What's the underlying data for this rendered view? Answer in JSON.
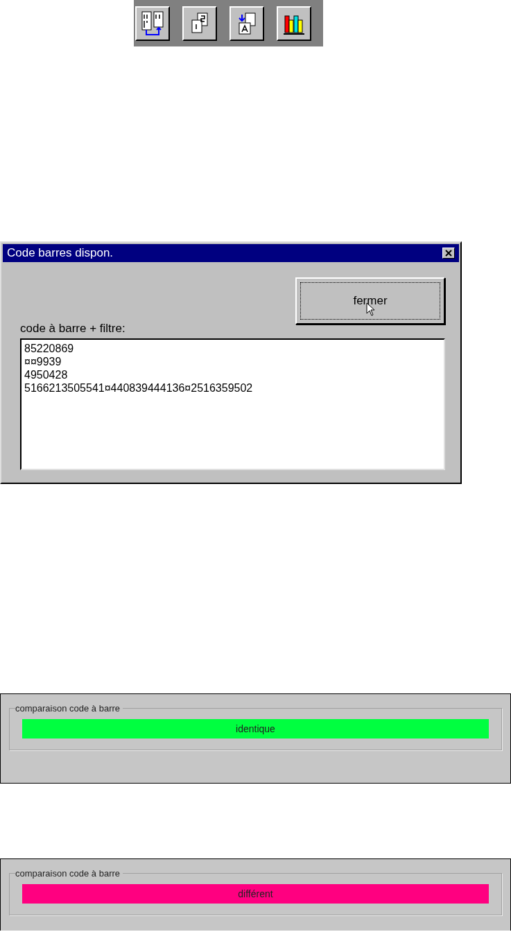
{
  "toolbar": {
    "buttons": [
      {
        "kind": "columns"
      },
      {
        "kind": "pages"
      },
      {
        "kind": "swap"
      },
      {
        "kind": "books"
      }
    ]
  },
  "dialog": {
    "title": "Code barres dispon.",
    "button": {
      "label": "fermer",
      "focused": true
    },
    "field_label": "code à barre + filtre:",
    "lines": [
      "85220869",
      "¤¤9939",
      "4950428",
      "5166213505541¤440839444136¤2516359502"
    ]
  },
  "comparisons": [
    {
      "title": "comparaison code à barre",
      "result": "identique",
      "color": "#00ff40"
    },
    {
      "title": "comparaison code à barre",
      "result": "différent",
      "color": "#ff0080"
    }
  ]
}
